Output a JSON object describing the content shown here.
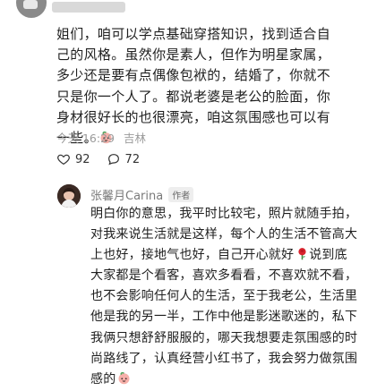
{
  "comment": {
    "text_main": "姐们，咱可以学点基础穿搭知识，找到适合自己的风格。虽然你是素人，但作为明星家属，多少还是要有点偶像包袱的，结婚了，你就不只是你一个人了。都说老婆是老公的脸面，你身材很好长的也很漂亮，咱这氛围感也可以有一些。",
    "date": "今天 16:29",
    "location": "吉林",
    "likes": "92",
    "replies": "72"
  },
  "reply": {
    "name": "张馨月Carina",
    "badge": "作者",
    "text_a": "明白你的意思，我平时比较宅，照片就随手拍，对我来说生活就是这样，每个人的生活不管高大上也好，接地气也好，自己开心就好",
    "text_b": "说到底大家都是个看客，喜欢多看看，不喜欢就不看，也不会影响任何人的生活，至于我老公，生活里他是我的另一半，工作中他是影迷歌迷的，私下我俩只想舒舒服服的，哪天我想要走氛围感的时尚路线了，认真经营小红书了，我会努力做氛围感的"
  },
  "icons": {
    "emoji_1": "peach-face-emoji",
    "emoji_2": "red-rose-emoji",
    "emoji_3": "peach-face-emoji",
    "like": "heart-outline-icon",
    "comment": "speech-bubble-icon"
  },
  "colors": {
    "meta_gray": "#9a9a9a",
    "badge_bg": "#eeeeee",
    "emoji_pink": "#f3a3a3",
    "rose_red": "#d9232d"
  }
}
